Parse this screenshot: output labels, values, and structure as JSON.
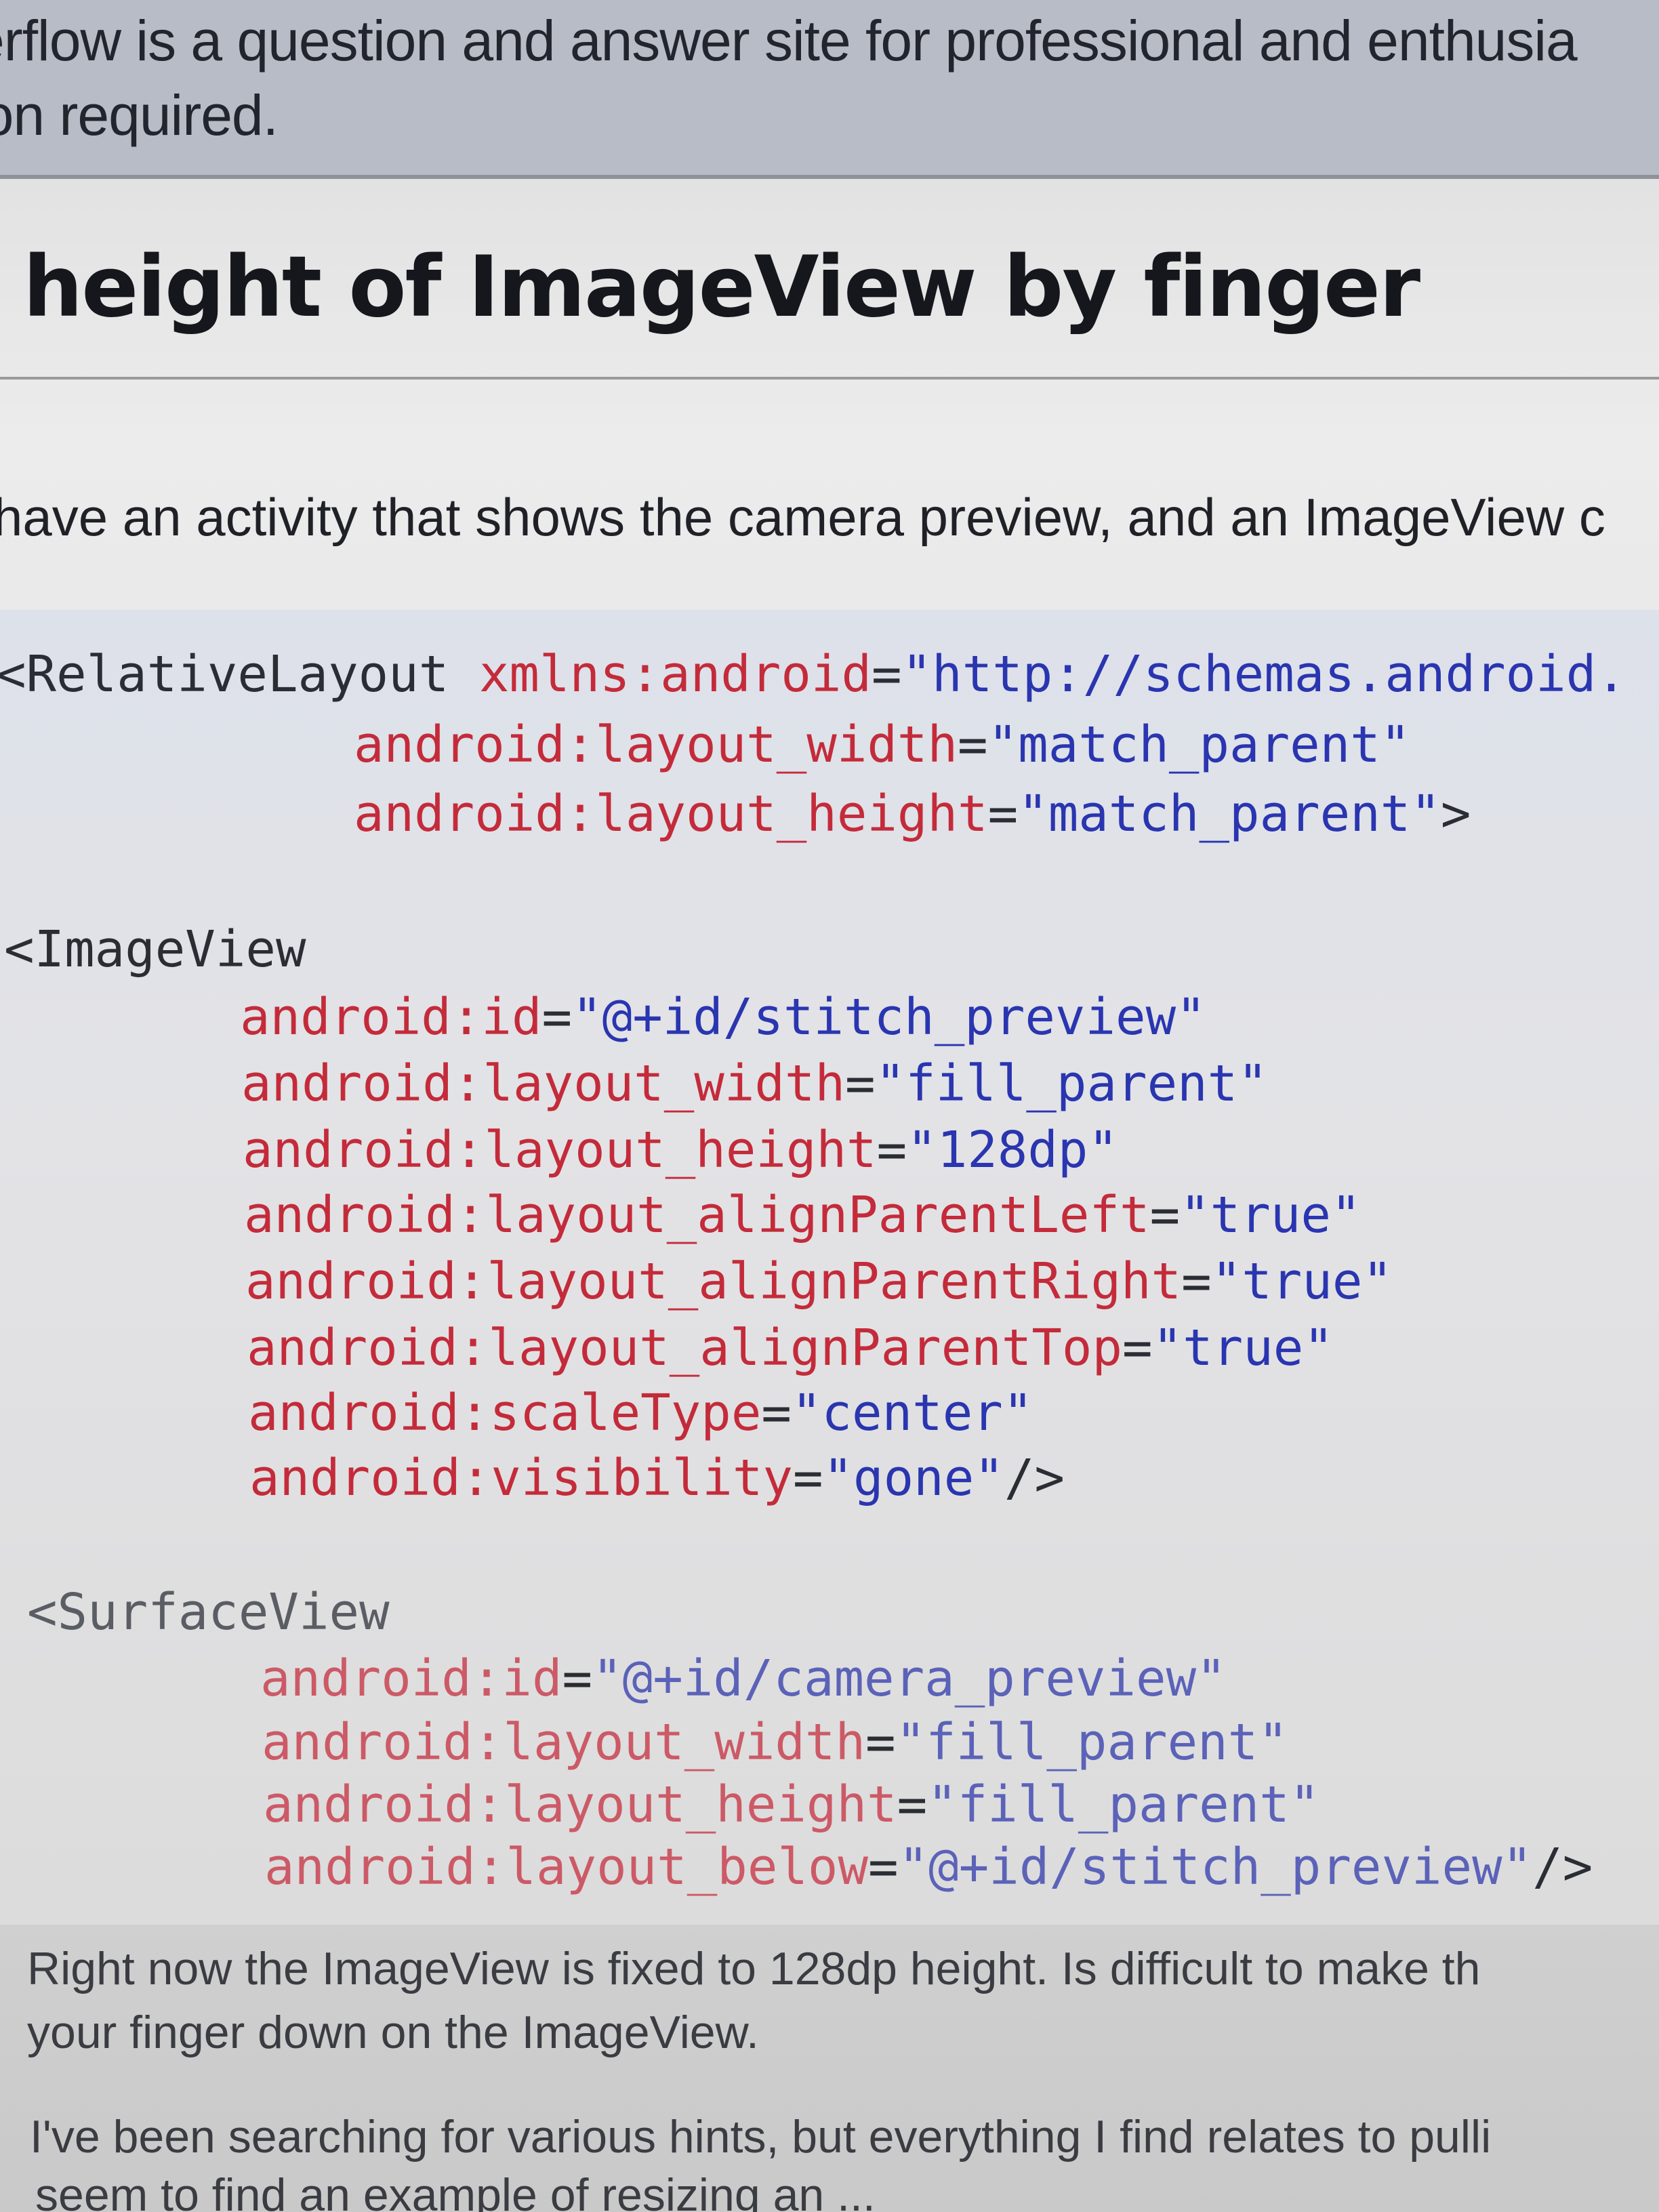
{
  "banner": {
    "line1": "erflow is a question and answer site for professional and enthusia",
    "line2": "ion required."
  },
  "question": {
    "title": "height of ImageView by finger",
    "intro": "have an activity that shows the camera preview, and an ImageView c"
  },
  "code": {
    "relative_layout": {
      "tag": "<RelativeLayout",
      "xmlns_attr": "xmlns:android",
      "xmlns_val": "\"http://schemas.android.",
      "width_attr": "android:layout_width",
      "width_val": "\"match_parent\"",
      "height_attr": "android:layout_height",
      "height_val": "\"match_parent\"",
      "close": ">"
    },
    "image_view": {
      "tag": "<ImageView",
      "attrs": [
        {
          "name": "android:id",
          "value": "\"@+id/stitch_preview\"",
          "end": ""
        },
        {
          "name": "android:layout_width",
          "value": "\"fill_parent\"",
          "end": ""
        },
        {
          "name": "android:layout_height",
          "value": "\"128dp\"",
          "end": ""
        },
        {
          "name": "android:layout_alignParentLeft",
          "value": "\"true\"",
          "end": ""
        },
        {
          "name": "android:layout_alignParentRight",
          "value": "\"true\"",
          "end": ""
        },
        {
          "name": "android:layout_alignParentTop",
          "value": "\"true\"",
          "end": ""
        },
        {
          "name": "android:scaleType",
          "value": "\"center\"",
          "end": ""
        },
        {
          "name": "android:visibility",
          "value": "\"gone\"",
          "end": "/>"
        }
      ]
    },
    "surface_view": {
      "tag": "<SurfaceView",
      "attrs": [
        {
          "name": "android:id",
          "value": "\"@+id/camera_preview\"",
          "end": ""
        },
        {
          "name": "android:layout_width",
          "value": "\"fill_parent\"",
          "end": ""
        },
        {
          "name": "android:layout_height",
          "value": "\"fill_parent\"",
          "end": ""
        },
        {
          "name": "android:layout_below",
          "value": "\"@+id/stitch_preview\"",
          "end": "/>"
        }
      ]
    },
    "eq": "="
  },
  "body": {
    "p1_line1": "Right now the ImageView is fixed to  128dp  height. Is difficult to make th",
    "p1_line2": "your finger down on the ImageView.",
    "p2_line1": "I've been searching for various hints, but everything I find relates to pulli",
    "p2_line2": "seem to find an example of resizing an ..."
  },
  "colors": {
    "code_attr": "#c42b3a",
    "code_value": "#2a35b0",
    "code_tag": "#2a2d33",
    "banner_bg": "#b8bcc6"
  }
}
